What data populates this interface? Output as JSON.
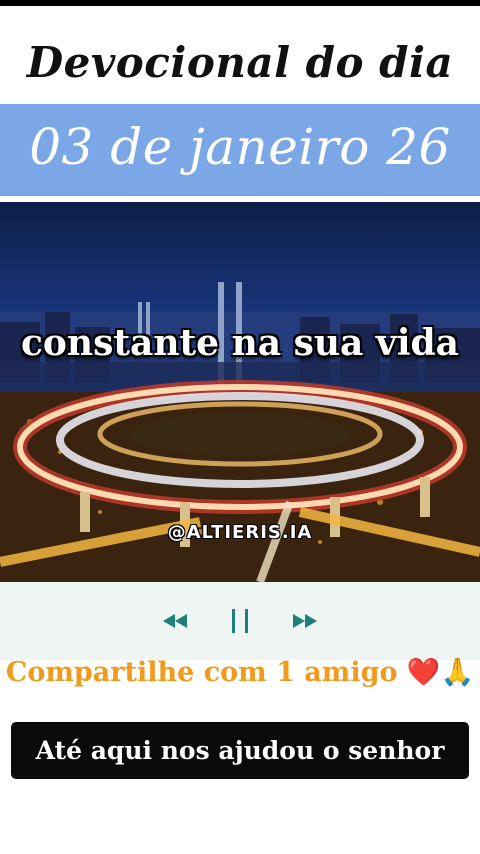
{
  "header": {
    "title": "Devocional do dia",
    "date": "03 de janeiro 26"
  },
  "media": {
    "overlay_text": "constante na sua vida",
    "watermark": "@ALTIERIS.IA"
  },
  "player": {
    "rewind_icon": "rewind-icon",
    "pause_icon": "pause-icon",
    "forward_icon": "fast-forward-icon"
  },
  "share": {
    "text": "Compartilhe com 1 amigo",
    "emoji_heart": "❤️",
    "emoji_pray": "🙏"
  },
  "footer": {
    "button_label": "Até aqui nos ajudou o senhor"
  },
  "colors": {
    "date_band": "#7ba7e6",
    "controls_teal": "#1f7f7a",
    "share_orange": "#f29a1e",
    "button_bg": "#0b0b0b"
  }
}
